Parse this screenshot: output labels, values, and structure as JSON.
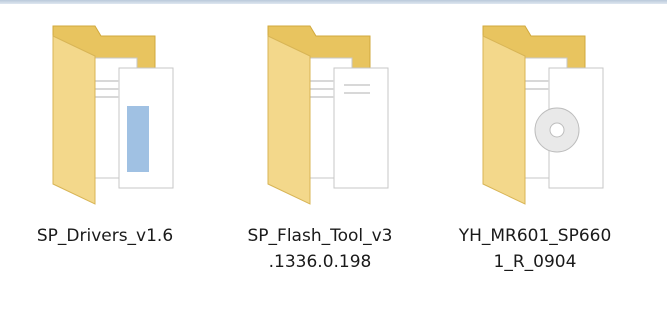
{
  "files": [
    {
      "name": "SP_Drivers_v1.6",
      "icon": "folder-with-documents-icon"
    },
    {
      "name": "SP_Flash_Tool_v3\n.1336.0.198",
      "icon": "folder-with-documents-icon"
    },
    {
      "name": "YH_MR601_SP660\n1_R_0904",
      "icon": "folder-with-documents-icon"
    }
  ],
  "colors": {
    "folder_front": "#f3d88b",
    "folder_back": "#e8c45f",
    "paper": "#ffffff",
    "accent_blue": "#8fb6de"
  }
}
